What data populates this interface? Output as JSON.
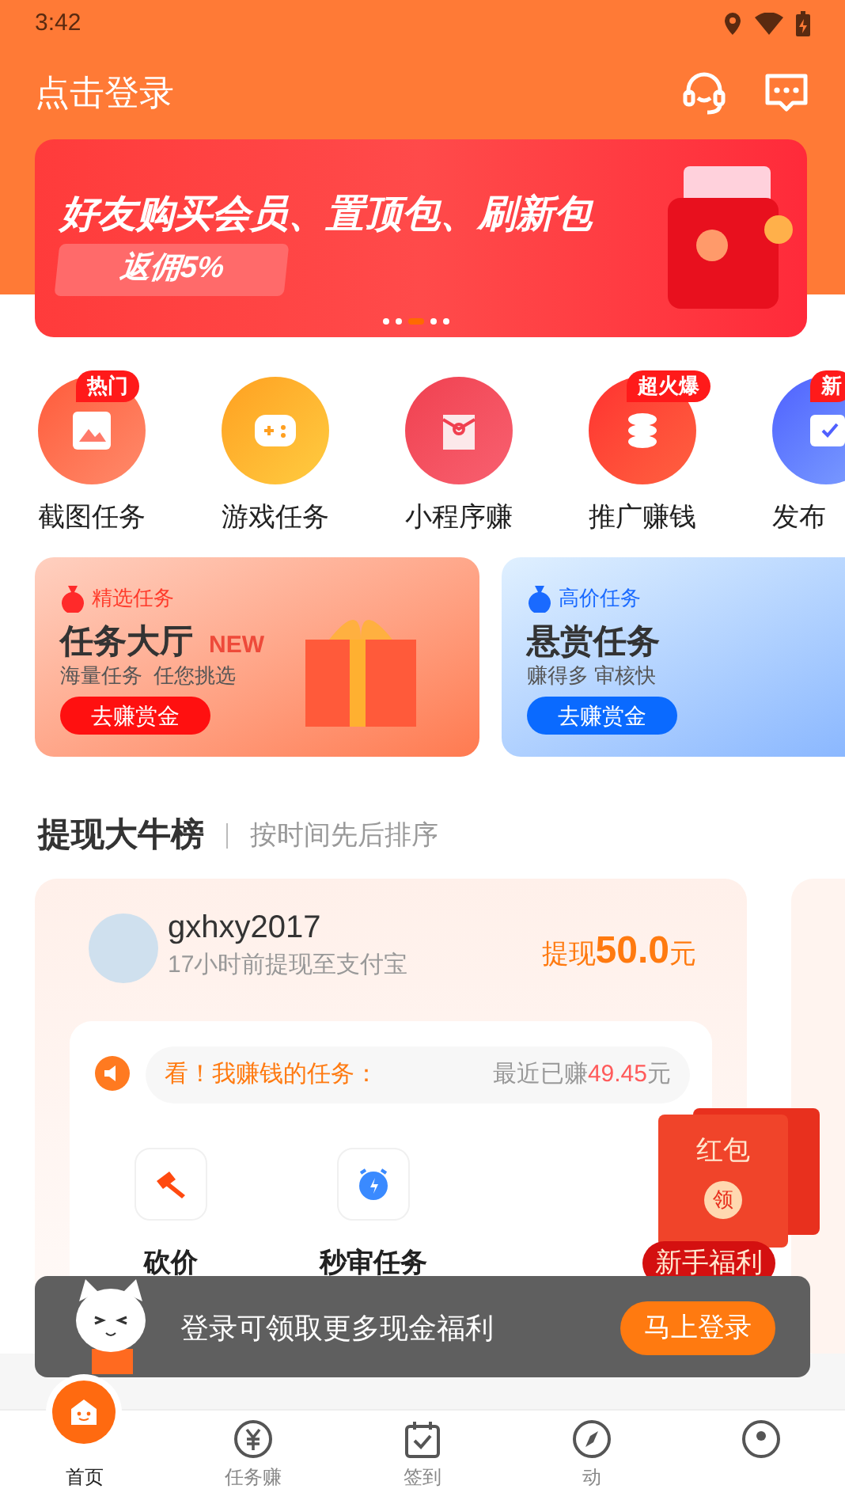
{
  "status_bar": {
    "time": "3:42"
  },
  "header": {
    "title": "点击登录"
  },
  "banner": {
    "headline": "好友购买会员、置顶包、刷新包",
    "ribbon": "返佣5%",
    "dots": [
      {
        "selected": false
      },
      {
        "selected": false
      },
      {
        "selected": true
      },
      {
        "selected": false
      },
      {
        "selected": false
      }
    ]
  },
  "shortcuts": [
    {
      "label": "截图任务",
      "badge": "热门",
      "kind": "screenshot"
    },
    {
      "label": "游戏任务",
      "kind": "game"
    },
    {
      "label": "小程序赚",
      "kind": "envelope"
    },
    {
      "label": "推广赚钱",
      "badge": "超火爆",
      "kind": "coins"
    },
    {
      "label": "发布",
      "badge": "新",
      "kind": "publish"
    }
  ],
  "promo_cards": [
    {
      "kind": "orange",
      "tag": "精选任务",
      "title": "任务大厅",
      "new_mark": "NEW",
      "subtitle": "海量任务  任您挑选",
      "button": "去赚赏金"
    },
    {
      "kind": "blue",
      "tag": "高价任务",
      "title": "悬赏任务",
      "subtitle": "赚得多 审核快",
      "button": "去赚赏金"
    }
  ],
  "leaderboard": {
    "title": "提现大牛榜",
    "subtitle": "按时间先后排序",
    "entry": {
      "username": "gxhxy2017",
      "detail": "17小时前提现至支付宝",
      "amount_prefix": "提现",
      "amount": "50.0",
      "amount_unit": "元",
      "notice": "看！我赚钱的任务：",
      "earned_label": "最近已赚",
      "earned_amount": "49.45",
      "earned_unit": "元",
      "tasks": [
        {
          "label": "砍价",
          "kind": "axe"
        },
        {
          "label": "秒审任务",
          "kind": "alarm"
        }
      ]
    }
  },
  "red_packet": {
    "title": "红包",
    "seal": "领",
    "caption": "新手福利"
  },
  "login_toast": {
    "message": "登录可领取更多现金福利",
    "button": "马上登录"
  },
  "bottom_nav": [
    {
      "label": "首页",
      "kind": "home",
      "selected": true
    },
    {
      "label": "任务赚",
      "kind": "yuan",
      "selected": false
    },
    {
      "label": "签到",
      "kind": "calendar",
      "selected": false
    },
    {
      "label": "动",
      "kind": "compass",
      "selected": false
    },
    {
      "kind": "profile",
      "selected": false
    }
  ]
}
